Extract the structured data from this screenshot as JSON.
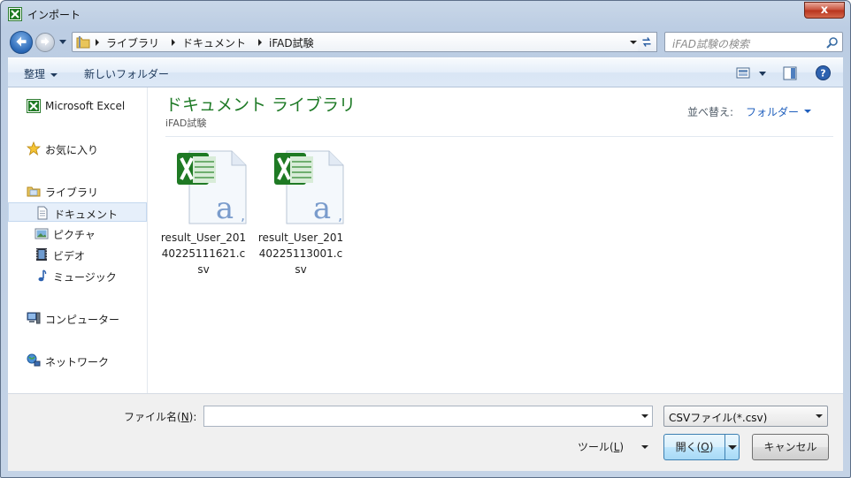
{
  "window": {
    "title": "インポート",
    "close_glyph": "x"
  },
  "navigation": {
    "breadcrumbs": [
      "ライブラリ",
      "ドキュメント",
      "iFAD試験"
    ],
    "search_placeholder": "iFAD試験の検索"
  },
  "toolbar": {
    "organize_label": "整理",
    "new_folder_label": "新しいフォルダー"
  },
  "sidebar": {
    "items": [
      {
        "label": "Microsoft Excel",
        "icon": "excel-icon"
      },
      {
        "label": "お気に入り",
        "icon": "star-icon"
      },
      {
        "label": "ライブラリ",
        "icon": "library-icon"
      },
      {
        "label": "ドキュメント",
        "icon": "document-icon",
        "selected": true
      },
      {
        "label": "ピクチャ",
        "icon": "picture-icon"
      },
      {
        "label": "ビデオ",
        "icon": "video-icon"
      },
      {
        "label": "ミュージック",
        "icon": "music-icon"
      },
      {
        "label": "コンピューター",
        "icon": "computer-icon"
      },
      {
        "label": "ネットワーク",
        "icon": "network-icon"
      }
    ]
  },
  "content": {
    "library_title": "ドキュメント ライブラリ",
    "library_subtitle": "iFAD試験",
    "sort_label": "並べ替え:",
    "sort_value": "フォルダー",
    "files": [
      {
        "name": "result_User_20140225111621.csv",
        "icon": "excel-csv-file-icon"
      },
      {
        "name": "result_User_20140225113001.csv",
        "icon": "excel-csv-file-icon"
      }
    ]
  },
  "footer": {
    "filename_label": "ファイル名(",
    "filename_mnemonic": "N",
    "filename_label_end": "):",
    "filename_value": "",
    "filetype_value": "CSVファイル(*.csv)",
    "tools_label": "ツール(",
    "tools_mnemonic": "L",
    "tools_label_end": ")",
    "open_label": "開く(",
    "open_mnemonic": "O",
    "open_label_end": ")",
    "cancel_label": "キャンセル"
  },
  "colors": {
    "library_title": "#1e7a26",
    "sort_value": "#1f5fbd",
    "accent": "#3c7fb1"
  }
}
